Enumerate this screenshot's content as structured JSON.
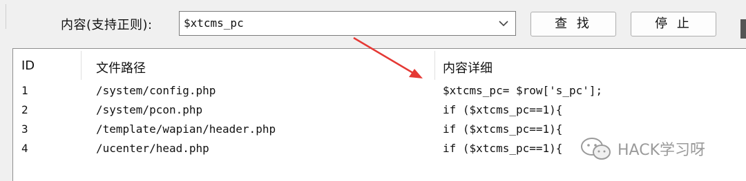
{
  "search": {
    "label": "内容(支持正则):",
    "value": "$xtcms_pc"
  },
  "buttons": {
    "find": "查 找",
    "stop": "停 止"
  },
  "table": {
    "columns": [
      "ID",
      "文件路径",
      "内容详细"
    ],
    "rows": [
      {
        "id": "1",
        "path": "/system/config.php",
        "detail": "$xtcms_pc= $row['s_pc'];"
      },
      {
        "id": "2",
        "path": "/system/pcon.php",
        "detail": "if ($xtcms_pc==1){"
      },
      {
        "id": "3",
        "path": "/template/wapian/header.php",
        "detail": "if ($xtcms_pc==1){"
      },
      {
        "id": "4",
        "path": "/ucenter/head.php",
        "detail": "if ($xtcms_pc==1){"
      }
    ]
  },
  "watermark": {
    "text": "HACK学习呀",
    "icon": "wechat-icon"
  },
  "annotation": {
    "arrow_color": "#e53935"
  }
}
